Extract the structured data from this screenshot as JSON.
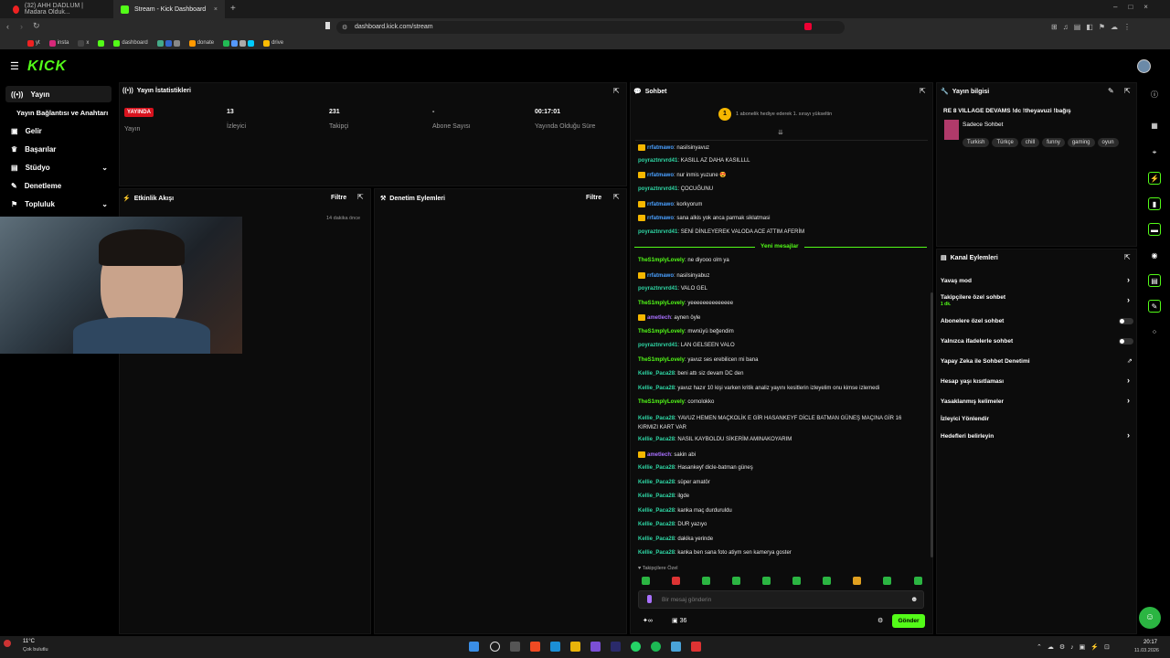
{
  "browser": {
    "tabs": [
      {
        "label": "(32) AHH DADLUM | Madara Olduk..."
      },
      {
        "label": "Stream - Kick Dashboard"
      }
    ],
    "url": "dashboard.kick.com/stream",
    "bookmarks": [
      "yt",
      "insta",
      "x",
      "dashboard",
      "donate",
      "drive"
    ]
  },
  "brand": {
    "logo_text": "KICK",
    "accent": "#53fc18"
  },
  "sidebar": {
    "items": [
      {
        "label": "Yayın",
        "icon": "broadcast-icon"
      },
      {
        "label": "Yayın Bağlantısı ve Anahtarı",
        "icon": ""
      },
      {
        "label": "Gelir",
        "icon": "wallet-icon"
      },
      {
        "label": "Başarılar",
        "icon": "trophy-icon"
      },
      {
        "label": "Stüdyo",
        "icon": "studio-icon"
      },
      {
        "label": "Denetleme",
        "icon": "shield-icon"
      },
      {
        "label": "Topluluk",
        "icon": "community-icon"
      }
    ]
  },
  "stats": {
    "title": "Yayın İstatistikleri",
    "status_badge": "YAYINDA",
    "status_label": "Yayın",
    "viewers_value": "13",
    "viewers_label": "İzleyici",
    "followers_value": "231",
    "followers_label": "Takipçi",
    "subs_value": "-",
    "subs_label": "Abone Sayısı",
    "duration_value": "00:17:01",
    "duration_label": "Yayında Olduğu Süre"
  },
  "activity": {
    "title": "Etkinlik Akışı",
    "filter": "Filtre",
    "item_time": "14 dakika önce"
  },
  "moderation": {
    "title": "Denetim Eylemleri",
    "filter": "Filtre"
  },
  "chat": {
    "title": "Sohbet",
    "pinned": "1 abonelik hediye ederek 1. sırayı yükseltin",
    "new_messages": "Yeni mesajlar",
    "messages": [
      {
        "user": "rrfatmawo",
        "text": "nasilsinyavuz",
        "color": "#4aa0ff"
      },
      {
        "user": "poyraztnrvrd41",
        "text": "KASILL AZ DAHA KASILLLL",
        "color": "#2fd7a5"
      },
      {
        "user": "rrfatmawo",
        "text": "nur inmis yuzune 😍",
        "color": "#4aa0ff"
      },
      {
        "user": "poyraztnrvrd41",
        "text": "ÇOCUĞUNU",
        "color": "#2fd7a5"
      },
      {
        "user": "rrfatmawo",
        "text": "korkyorum",
        "color": "#4aa0ff"
      },
      {
        "user": "rrfatmawo",
        "text": "sana alkis yok anca parmak siklatmasi",
        "color": "#4aa0ff"
      },
      {
        "user": "poyraztnrvrd41",
        "text": "SENİ DİNLEYEREK VALODA ACE ATTIM AFERİM",
        "color": "#2fd7a5"
      },
      {
        "user": "TheS1mplyLovely",
        "text": "ne diyooo olm ya",
        "color": "#53fc18"
      },
      {
        "user": "rrfatmawo",
        "text": "nasilsinyabuz",
        "color": "#4aa0ff"
      },
      {
        "user": "poyraztnrvrd41",
        "text": "VALO GEL",
        "color": "#2fd7a5"
      },
      {
        "user": "TheS1mplyLovely",
        "text": "yeeeeeeeeeeeeee",
        "color": "#53fc18"
      },
      {
        "user": "ametlech",
        "text": "aynen öyle",
        "color": "#a970ff"
      },
      {
        "user": "TheS1mplyLovely",
        "text": "mwnüyü beğendim",
        "color": "#53fc18"
      },
      {
        "user": "poyraztnrvrd41",
        "text": "LAN GELSEEN VALO",
        "color": "#2fd7a5"
      },
      {
        "user": "TheS1mplyLovely",
        "text": "yavuz ses erebilicen mi bana",
        "color": "#53fc18"
      },
      {
        "user": "Kellie_Paca28",
        "text": "beni attı siz devam DC den",
        "color": "#2fd7a5"
      },
      {
        "user": "Kellie_Paca28",
        "text": "yavuz hazır 10 kişi varken kritik analiz yayını kesitlerin izleyelim onu kimse izlemedi",
        "color": "#2fd7a5"
      },
      {
        "user": "TheS1mplyLovely",
        "text": "cornolokko",
        "color": "#53fc18"
      },
      {
        "user": "Kellie_Paca28",
        "text": "YAVUZ HEMEN MAÇKOLİK E GİR HASANKEYF DİCLE BATMAN GÜNEŞ MAÇINA GİR 16 KIRMIZI KART VAR",
        "color": "#2fd7a5"
      },
      {
        "user": "Kellie_Paca28",
        "text": "NASIL KAYBOLDU SİKERİM AMINAKOYARIM",
        "color": "#2fd7a5"
      },
      {
        "user": "ametlech",
        "text": "sakin abi",
        "color": "#a970ff"
      },
      {
        "user": "Kellie_Paca28",
        "text": "Hasankeyf dicle-batman güneş",
        "color": "#2fd7a5"
      },
      {
        "user": "Kellie_Paca28",
        "text": "süper amatör",
        "color": "#2fd7a5"
      },
      {
        "user": "Kellie_Paca28",
        "text": "ilgde",
        "color": "#2fd7a5"
      },
      {
        "user": "Kellie_Paca28",
        "text": "kanka maç durduruldu",
        "color": "#2fd7a5"
      },
      {
        "user": "Kellie_Paca28",
        "text": "DUR yazıyo",
        "color": "#2fd7a5"
      },
      {
        "user": "Kellie_Paca28",
        "text": "dakika yerinde",
        "color": "#2fd7a5"
      },
      {
        "user": "Kellie_Paca28",
        "text": "kanka ben sana foto atiym sen kamerya goster",
        "color": "#2fd7a5"
      }
    ],
    "followers_only": "Takipçilere Özel",
    "input_placeholder": "Bir mesaj gönderin",
    "points": "36",
    "send": "Gönder"
  },
  "stream_info": {
    "title": "Yayın bilgisi",
    "stream_title": "RE 8 VILLAGE DEVAMS !dc !theyavuzi !bağış",
    "category": "Sadece Sohbet",
    "tags": [
      "Turkish",
      "Türkçe",
      "chill",
      "funny",
      "gaming",
      "oyun"
    ]
  },
  "channel_actions": {
    "title": "Kanal Eylemleri",
    "slow_mode": "Yavaş mod",
    "followers_chat": "Takipçilere özel sohbet",
    "followers_chat_sub": "1 dk.",
    "subscribers_chat": "Abonelere özel sohbet",
    "emotes_chat": "Yalnızca ifadelerle sohbet",
    "ai_moderation": "Yapay Zeka ile Sohbet Denetimi",
    "age_restriction": "Hesap yaşı kısıtlaması",
    "banned_words": "Yasaklanmış kelimeler",
    "viewer_redirect": "İzleyici Yönlendir",
    "set_goals": "Hedefleri belirleyin"
  },
  "taskbar": {
    "weather_temp": "11°C",
    "weather_desc": "Çok bulutlu",
    "time": "20:17",
    "date": "11.03.2026"
  }
}
